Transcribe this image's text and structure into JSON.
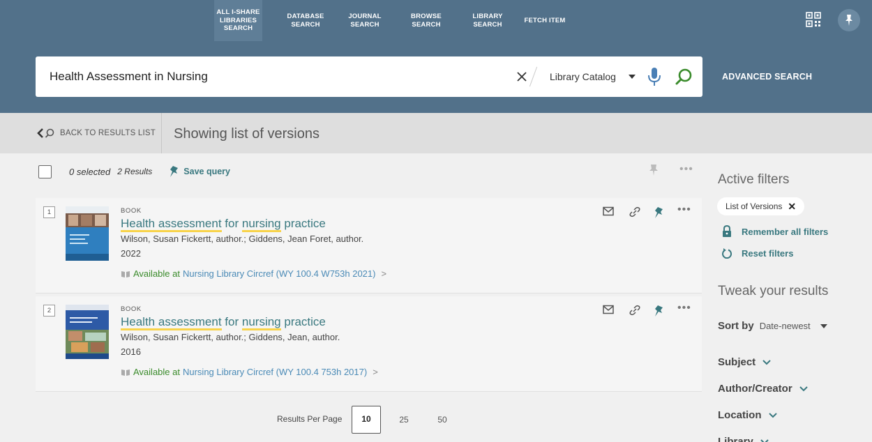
{
  "topnav": {
    "items": [
      {
        "label": "ALL I-SHARE\nLIBRARIES\nSEARCH"
      },
      {
        "label": "DATABASE\nSEARCH"
      },
      {
        "label": "JOURNAL\nSEARCH"
      },
      {
        "label": "BROWSE\nSEARCH"
      },
      {
        "label": "LIBRARY\nSEARCH"
      },
      {
        "label": "FETCH ITEM"
      }
    ]
  },
  "search": {
    "query": "Health Assessment in Nursing",
    "scope": "Library Catalog",
    "advanced_label": "ADVANCED SEARCH"
  },
  "versions": {
    "back_label": "BACK TO RESULTS LIST",
    "heading": "Showing list of versions"
  },
  "toolbar": {
    "selected": "0 selected",
    "results": "2 Results",
    "save_query": "Save query"
  },
  "results": [
    {
      "num": "1",
      "type": "BOOK",
      "title_hl1": "Health assessment",
      "title_mid": " for ",
      "title_hl2": "nursing",
      "title_end": " practice",
      "author": "Wilson, Susan Fickertt, author.; Giddens, Jean Foret, author.",
      "year": "2022",
      "availability": "Available at",
      "location": "Nursing Library  Circref (WY 100.4 W753h 2021)"
    },
    {
      "num": "2",
      "type": "BOOK",
      "title_hl1": "Health assessment",
      "title_mid": " for ",
      "title_hl2": "nursing",
      "title_end": " practice",
      "author": "Wilson, Susan Fickertt, author.; Giddens, Jean, author.",
      "year": "2016",
      "availability": "Available at",
      "location": "Nursing Library  Circref (WY 100.4 753h 2017)"
    }
  ],
  "pagination": {
    "label": "Results Per Page",
    "options": [
      "10",
      "25",
      "50"
    ]
  },
  "sidebar": {
    "active_filters": "Active filters",
    "chip": "List of Versions",
    "remember": "Remember all filters",
    "reset": "Reset filters",
    "tweak": "Tweak your results",
    "sort_label": "Sort by",
    "sort_value": "Date-newest",
    "facets": [
      "Subject",
      "Author/Creator",
      "Location",
      "Library"
    ]
  },
  "colors": {
    "header": "#52718a",
    "teal": "#39787f",
    "available": "#3a8b2b",
    "highlight": "#f8d34a"
  }
}
